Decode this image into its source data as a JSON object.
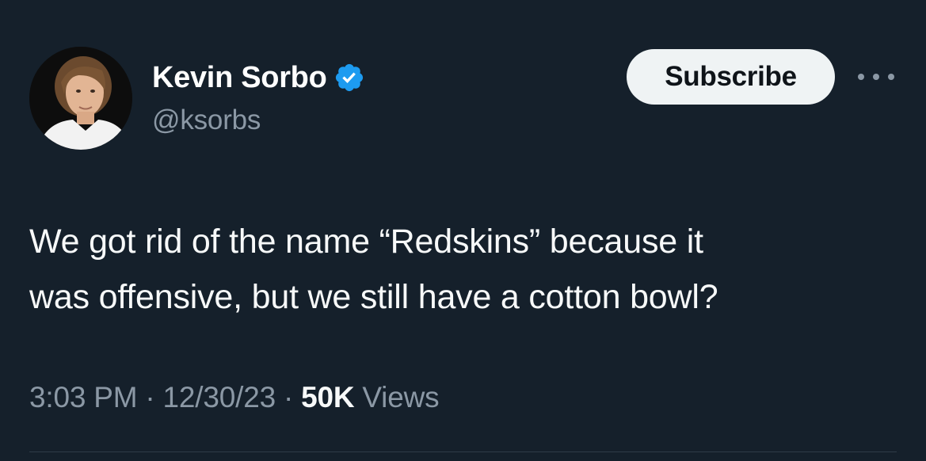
{
  "author": {
    "display_name": "Kevin Sorbo",
    "handle": "@ksorbs",
    "verified": true
  },
  "actions": {
    "subscribe_label": "Subscribe",
    "more_icon": "more-horizontal-icon"
  },
  "tweet": {
    "text_line1": "We got rid of the name “Redskins” because it",
    "text_line2": "was offensive, but we still have a cotton bowl?",
    "time": "3:03 PM",
    "date": "12/30/23",
    "views_count": "50K",
    "views_label": "Views",
    "separator": "·"
  },
  "colors": {
    "background": "#15202b",
    "text": "#f7f9f9",
    "secondary_text": "#8b98a5",
    "verified_badge": "#1d9bf0",
    "button_bg": "#eff3f4"
  }
}
